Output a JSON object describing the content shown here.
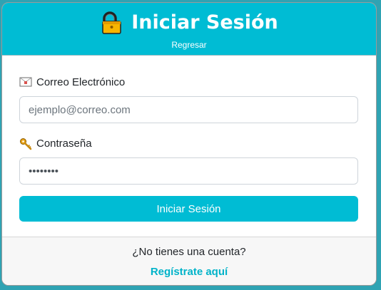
{
  "header": {
    "title": "Iniciar Sesión",
    "title_icon": "lock-icon",
    "back_link": "Regresar"
  },
  "form": {
    "email": {
      "label": "Correo Electrónico",
      "icon": "envelope-icon",
      "placeholder": "ejemplo@correo.com",
      "value": ""
    },
    "password": {
      "label": "Contraseña",
      "icon": "key-icon",
      "value": "••••••••"
    },
    "submit_label": "Iniciar Sesión"
  },
  "footer": {
    "prompt": "¿No tienes una cuenta?",
    "register_link": "Regístrate aquí"
  },
  "colors": {
    "accent": "#00bcd4",
    "link": "#00b3c9",
    "page_background": "#2fa3b3"
  }
}
